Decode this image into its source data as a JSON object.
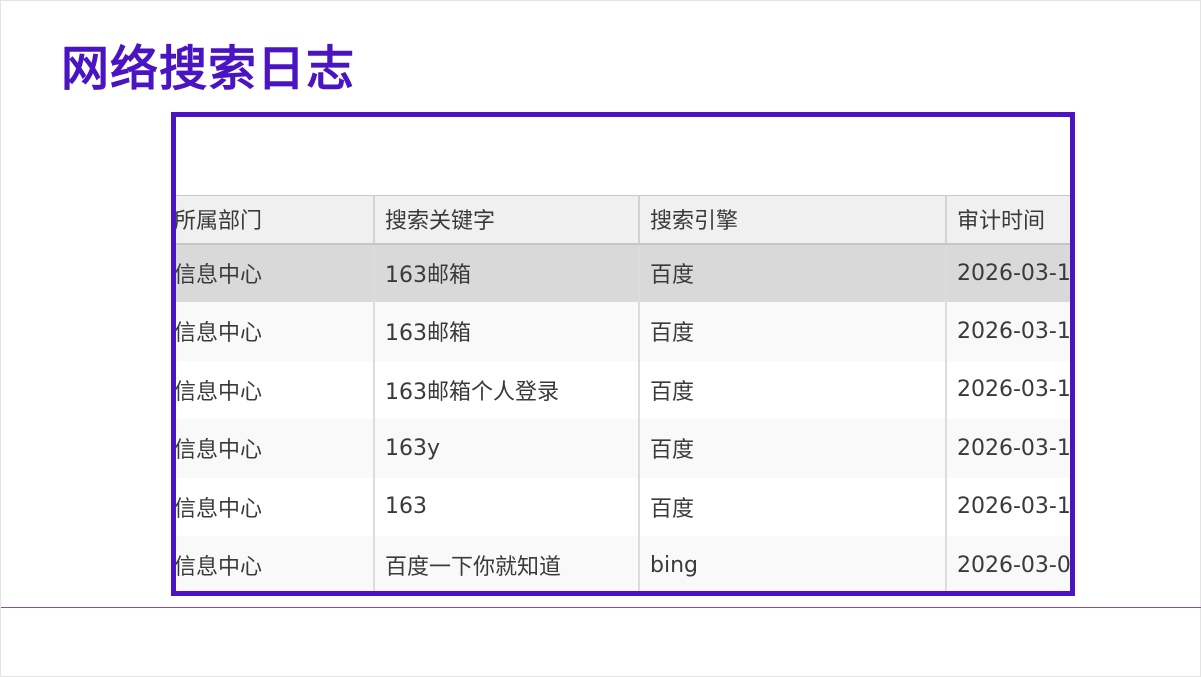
{
  "slide": {
    "title": "网络搜索日志",
    "accent_color": "#4b14c3"
  },
  "table": {
    "columns": [
      "所属部门",
      "搜索关键字",
      "搜索引擎",
      "审计时间"
    ],
    "rows": [
      {
        "dept": "信息中心",
        "keyword": "163邮箱",
        "engine": "百度",
        "time": "2026-03-1"
      },
      {
        "dept": "信息中心",
        "keyword": "163邮箱",
        "engine": "百度",
        "time": "2026-03-1"
      },
      {
        "dept": "信息中心",
        "keyword": "163邮箱个人登录",
        "engine": "百度",
        "time": "2026-03-1"
      },
      {
        "dept": "信息中心",
        "keyword": "163y",
        "engine": "百度",
        "time": "2026-03-1"
      },
      {
        "dept": "信息中心",
        "keyword": "163",
        "engine": "百度",
        "time": "2026-03-1"
      },
      {
        "dept": "信息中心",
        "keyword": "百度一下你就知道",
        "engine": "bing",
        "time": "2026-03-0"
      }
    ]
  }
}
